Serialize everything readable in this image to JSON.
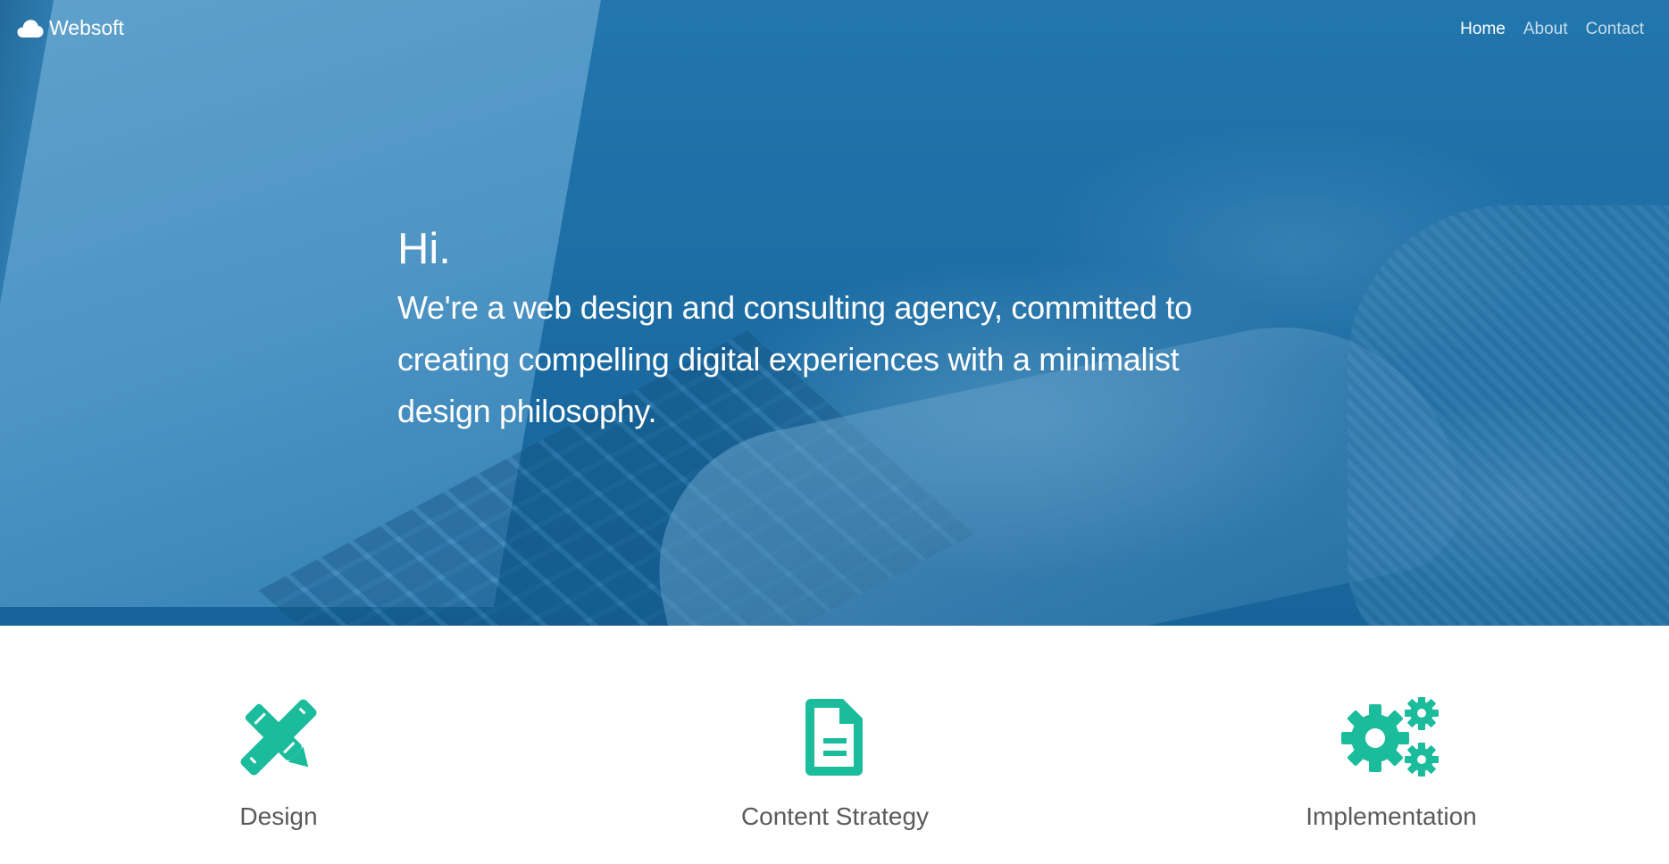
{
  "brand": {
    "name": "Websoft",
    "icon": "cloud-icon"
  },
  "nav": {
    "items": [
      {
        "label": "Home",
        "active": true
      },
      {
        "label": "About",
        "active": false
      },
      {
        "label": "Contact",
        "active": false
      }
    ]
  },
  "hero": {
    "heading": "Hi.",
    "text": "We're a web design and consulting agency, committed to creating compelling digital experiences with a minimalist design philosophy."
  },
  "features": [
    {
      "title": "Design",
      "icon": "pencil-ruler-icon"
    },
    {
      "title": "Content Strategy",
      "icon": "document-icon"
    },
    {
      "title": "Implementation",
      "icon": "gears-icon"
    }
  ],
  "colors": {
    "accent": "#1abc9c",
    "hero_overlay": "#1a6fa6",
    "text_dark": "#5a5a5a",
    "text_light": "#ffffff"
  }
}
